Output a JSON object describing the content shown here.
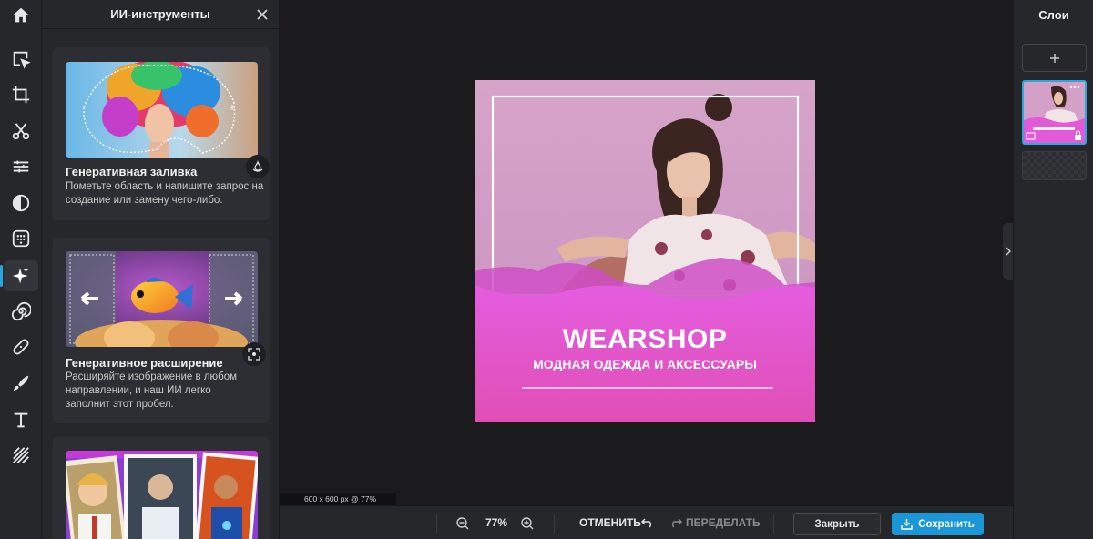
{
  "panel": {
    "title": "ИИ-инструменты",
    "cards": [
      {
        "title": "Генеративная заливка",
        "description": "Пометьте область и напишите запрос на создание или замену чего-либо."
      },
      {
        "title": "Генеративное расширение",
        "description": "Расширяйте изображение в любом направлении, и наш ИИ легко заполнит этот пробел."
      }
    ]
  },
  "rail": {
    "tools": [
      "home-icon",
      "select-icon",
      "crop-icon",
      "cut-icon",
      "adjust-icon",
      "contrast-icon",
      "effects-icon",
      "ai-sparkle-icon",
      "spiral-icon",
      "bandage-icon",
      "brush-icon",
      "text-icon",
      "pattern-icon"
    ],
    "active": "ai-sparkle-icon"
  },
  "artwork": {
    "brand": "WEARSHOP",
    "tagline": "МОДНАЯ ОДЕЖДА И АКСЕССУАРЫ"
  },
  "stage": {
    "size_label": "600 x 600 px @ 77%"
  },
  "bottombar": {
    "zoom": "77%",
    "undo_label": "ОТМЕНИТЬ",
    "redo_label": "ПЕРЕДЕЛАТЬ",
    "close_label": "Закрыть",
    "save_label": "Сохранить"
  },
  "layers": {
    "title": "Слои"
  },
  "colors": {
    "accent": "#1b96d6",
    "artwork_pink": "#e35ad6"
  }
}
